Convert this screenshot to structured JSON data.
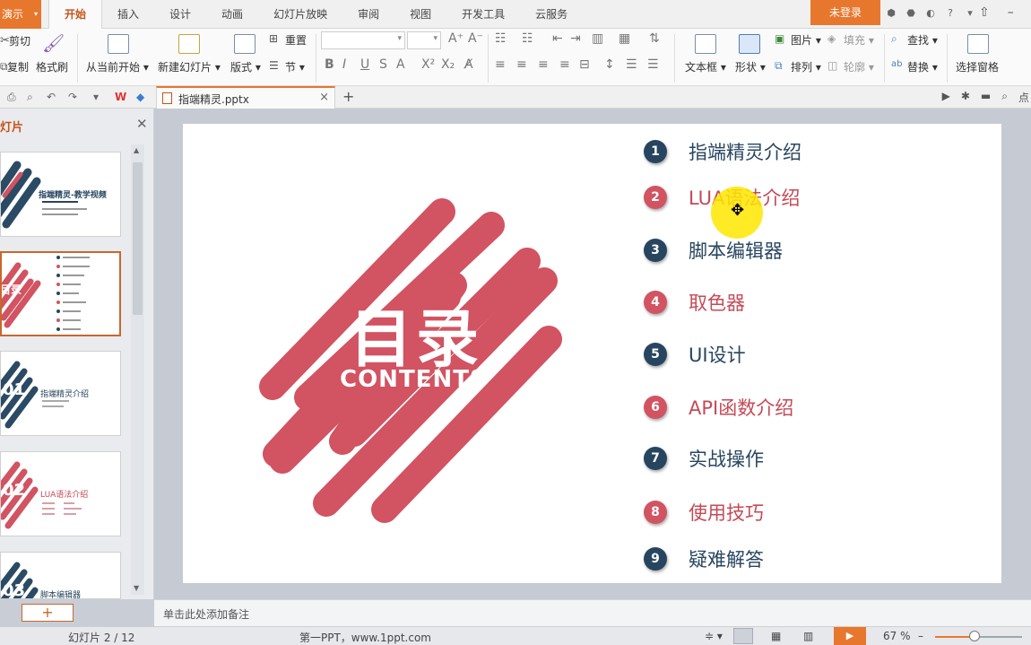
{
  "app": {
    "menu_label": "演示"
  },
  "tabs": [
    "开始",
    "插入",
    "设计",
    "动画",
    "幻灯片放映",
    "审阅",
    "视图",
    "开发工具",
    "云服务"
  ],
  "login_label": "未登录",
  "ribbon": {
    "cut": "剪切",
    "copy": "复制",
    "format_painter": "格式刷",
    "from_current": "从当前开始",
    "new_slide": "新建幻灯片",
    "layout": "版式",
    "reset": "重置",
    "section": "节",
    "textbox": "文本框",
    "shape": "形状",
    "picture": "图片",
    "fill": "填充",
    "arrange": "排列",
    "outline": "轮廓",
    "find": "查找",
    "replace": "替换",
    "select_pane": "选择窗格"
  },
  "doc_tab": {
    "filename": "指端精灵.pptx"
  },
  "left_pane": {
    "title": "灯片",
    "thumb1_title": "指端精灵-教学视频",
    "thumb2_title": "目录",
    "thumb3_title": "指端精灵介绍",
    "thumb3_num": "01",
    "thumb4_title": "LUA语法介绍",
    "thumb4_num": "02",
    "thumb5_title": "脚本编辑器",
    "thumb5_num": "03",
    "add_label": "+"
  },
  "slide": {
    "title": "目录",
    "subtitle": "CONTENTS",
    "items": [
      {
        "num": "1",
        "label": "指端精灵介绍",
        "style": "dark"
      },
      {
        "num": "2",
        "label": "LUA语法介绍",
        "style": "red"
      },
      {
        "num": "3",
        "label": "脚本编辑器",
        "style": "dark"
      },
      {
        "num": "4",
        "label": "取色器",
        "style": "red"
      },
      {
        "num": "5",
        "label": "UI设计",
        "style": "dark"
      },
      {
        "num": "6",
        "label": "API函数介绍",
        "style": "red"
      },
      {
        "num": "7",
        "label": "实战操作",
        "style": "dark"
      },
      {
        "num": "8",
        "label": "使用技巧",
        "style": "red"
      },
      {
        "num": "9",
        "label": "疑难解答",
        "style": "dark"
      }
    ],
    "colors": {
      "accent": "#d25361",
      "dark": "#27455f"
    }
  },
  "notes_placeholder": "单击此处添加备注",
  "status": {
    "slide_counter": "幻灯片 2 / 12",
    "theme": "第一PPT，www.1ppt.com",
    "zoom": "67 %",
    "zoom_level": 0.45
  },
  "quick_right": "点"
}
